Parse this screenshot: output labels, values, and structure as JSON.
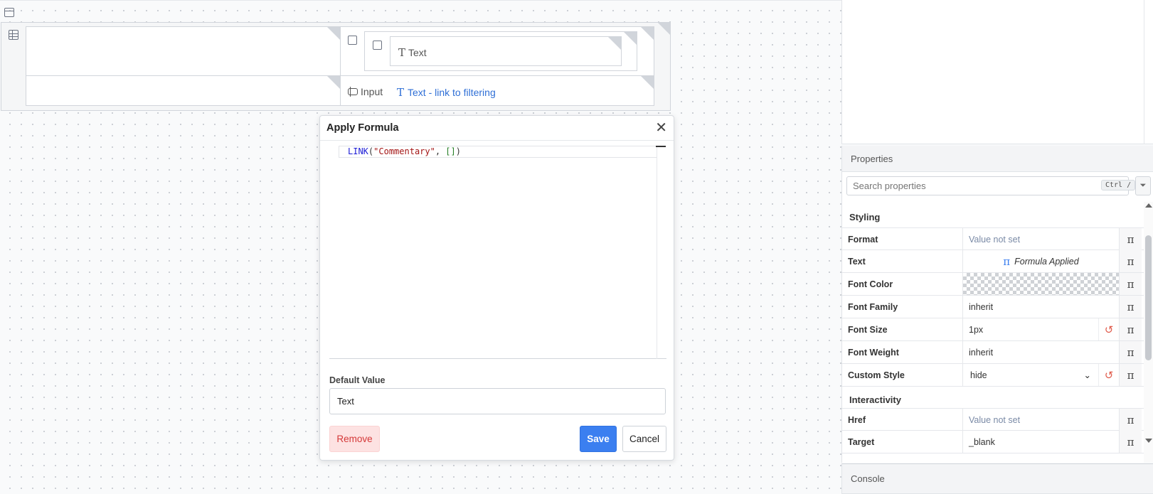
{
  "canvas": {
    "text_element_label": "Text",
    "input_label": "Input",
    "link_label": "Text - link to filtering"
  },
  "modal": {
    "title": "Apply Formula",
    "code": {
      "fn": "LINK",
      "open": "(",
      "str": "\"Commentary\"",
      "sep": ", ",
      "brackets": "[]",
      "close": ")"
    },
    "default_label": "Default Value",
    "default_value": "Text",
    "remove_label": "Remove",
    "save_label": "Save",
    "cancel_label": "Cancel"
  },
  "properties": {
    "header": "Properties",
    "search_placeholder": "Search properties",
    "shortcut": "Ctrl /",
    "sections": {
      "styling": "Styling",
      "interactivity": "Interactivity"
    },
    "rows": {
      "format": {
        "name": "Format",
        "value": "Value not set"
      },
      "text": {
        "name": "Text",
        "value": "Formula Applied"
      },
      "font_color": {
        "name": "Font Color"
      },
      "font_family": {
        "name": "Font Family",
        "value": "inherit"
      },
      "font_size": {
        "name": "Font Size",
        "value": "1px"
      },
      "font_weight": {
        "name": "Font Weight",
        "value": "inherit"
      },
      "custom_style": {
        "name": "Custom Style",
        "value": "hide"
      },
      "href": {
        "name": "Href",
        "value": "Value not set"
      },
      "target": {
        "name": "Target",
        "value": "_blank"
      }
    }
  },
  "console": {
    "header": "Console"
  },
  "icons": {
    "pi_symbol": "π",
    "close": "✕",
    "reset": "↺",
    "filter": "⏷",
    "text_glyph": "T"
  },
  "colors": {
    "accent": "#3b7ff0",
    "link": "#2f6fd6",
    "danger": "#d53838"
  }
}
